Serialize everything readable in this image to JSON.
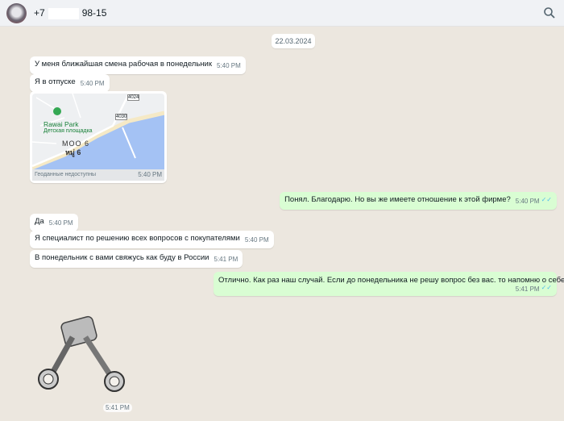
{
  "header": {
    "phone_prefix": "+7",
    "phone_suffix": "98-15"
  },
  "date_chip": "22.03.2024",
  "messages": [
    {
      "text": "У меня ближайшая смена рабочая в понедельник",
      "time": "5:40 PM"
    },
    {
      "text": "Я в отпуске",
      "time": "5:40 PM"
    },
    {
      "map": {
        "place": "Rawai Park",
        "place_sub": "Детская площадка",
        "area": "MOO 6",
        "area_th": "หมู่ 6",
        "road1": "4024",
        "road2": "4030",
        "footer": "Геоданные недоступны"
      },
      "time": "5:40 PM"
    },
    {
      "text": "Понял. Благодарю. Но вы же имеете отношение к этой фирме?",
      "time": "5:40 PM",
      "read": "✓✓"
    },
    {
      "text": "Да",
      "time": "5:40 PM"
    },
    {
      "text": "Я специалист по решению всех вопросов с покупателями",
      "time": "5:40 PM"
    },
    {
      "text": "В понедельник с вами свяжусь как буду в России",
      "time": "5:41 PM"
    },
    {
      "text": "Отлично. Как раз наш случай. Если до понедельника не решу вопрос без вас. то напомню о себе.",
      "time": "5:41 PM",
      "read": "✓✓"
    },
    {
      "sticker": "piston-sticker",
      "time": "5:41 PM"
    }
  ]
}
